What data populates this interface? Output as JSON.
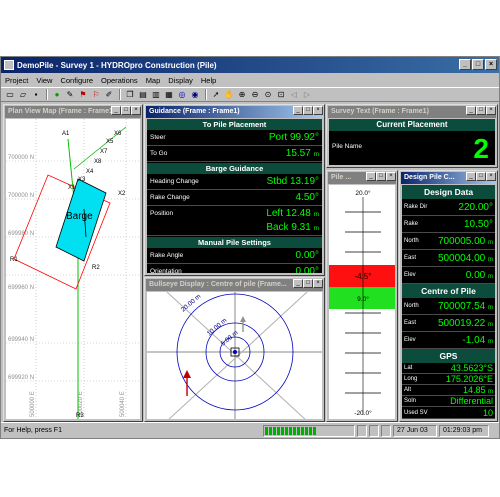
{
  "window": {
    "title": "DemoPile - Survey 1 - HYDROpro Construction (Pile)",
    "minimize": "_",
    "maximize": "□",
    "close": "×"
  },
  "menu": [
    "Project",
    "View",
    "Configure",
    "Operations",
    "Map",
    "Display",
    "Help"
  ],
  "toolbar": {
    "icons": [
      "new-file-icon",
      "open-file-icon",
      "save-icon",
      "record-icon",
      "pen-icon",
      "flag-icon",
      "flag-icon",
      "edit-icon",
      "copy-icon",
      "tile-icon",
      "cascade-icon",
      "grid-icon",
      "target-icon",
      "circle-icon",
      "pointer-icon",
      "hand-icon",
      "zoom-in-icon",
      "zoom-out-icon",
      "zoom-extent-icon",
      "zoom-window-icon",
      "back-icon",
      "forward-icon"
    ]
  },
  "plan_view": {
    "title": "Plan View Map (Frame : Frame1)",
    "grid_y_labels": [
      "700000 N",
      "700000 N",
      "699980 N",
      "699960 N",
      "699940 N",
      "699920 N"
    ],
    "grid_x_labels": [
      "500000 E",
      "500020 E",
      "500040 E"
    ],
    "barge_label": "Barge",
    "markers": [
      "X6",
      "X5",
      "X7",
      "X8",
      "X4",
      "X3",
      "X1",
      "X2",
      "R1",
      "R2",
      "R3",
      "A1"
    ],
    "colors": {
      "barge": "#00e0f0",
      "outline": "#ff0000",
      "track": "#00c000"
    }
  },
  "guidance": {
    "title": "Guidance (Frame : Frame1)",
    "section1": "To Pile Placement",
    "steer_label": "Steer",
    "steer_value": "Port 99.92°",
    "togo_label": "To Go",
    "togo_value": "15.57",
    "togo_unit": "m",
    "section2": "Barge Guidance",
    "heading_label": "Heading Change",
    "heading_value": "Stbd 13.19°",
    "rake_label": "Rake Change",
    "rake_value": "4.50°",
    "position_label": "Position",
    "position_value1": "Left 12.48",
    "position_value2": "Back 9.31",
    "position_unit": "m",
    "section3": "Manual Pile Settings",
    "rake_angle_label": "Rake Angle",
    "rake_angle_value": "0.00°",
    "orientation_label": "Orientation",
    "orientation_value": "0.00°"
  },
  "survey_text": {
    "title": "Survey Text (Frame : Frame1)",
    "header": "Current Placement",
    "pile_name_label": "Pile Name",
    "pile_name_value": "2"
  },
  "pile_gauge": {
    "title": "Pile ...",
    "top_label": "20.0°",
    "red_label": "-4.5°",
    "green_label": "9.0°",
    "bottom_label": "-20.0°"
  },
  "design_pile": {
    "title": "Design Pile C...",
    "section1": "Design Data",
    "rows1": [
      {
        "label": "Rake Dir",
        "value": "220.00°"
      },
      {
        "label": "Rake",
        "value": "10.50°"
      },
      {
        "label": "North",
        "value": "700005.00",
        "unit": "m"
      },
      {
        "label": "East",
        "value": "500004.00",
        "unit": "m"
      },
      {
        "label": "Elev",
        "value": "0.00",
        "unit": "m"
      }
    ],
    "section2": "Centre of Pile",
    "rows2": [
      {
        "label": "North",
        "value": "700007.54",
        "unit": "m"
      },
      {
        "label": "East",
        "value": "500019.22",
        "unit": "m"
      },
      {
        "label": "Elev",
        "value": "-1.04",
        "unit": "m"
      }
    ],
    "section3": "GPS",
    "rows3": [
      {
        "label": "Lat",
        "value": "43.5623°S"
      },
      {
        "label": "Long",
        "value": "175.2026°E"
      },
      {
        "label": "Alt",
        "value": "14.85",
        "unit": "m"
      },
      {
        "label": "Soln",
        "value": "Differential"
      },
      {
        "label": "Used SV",
        "value": "10"
      }
    ]
  },
  "bullseye": {
    "title": "Bullseye Display : Centre of pile (Frame...",
    "ring_labels": [
      "20.00 m",
      "10.00 m",
      "5.00 m"
    ]
  },
  "status": {
    "help": "For Help, press F1",
    "date": "27 Jun 03",
    "time": "01:29:03 pm",
    "progress": 0.7
  }
}
